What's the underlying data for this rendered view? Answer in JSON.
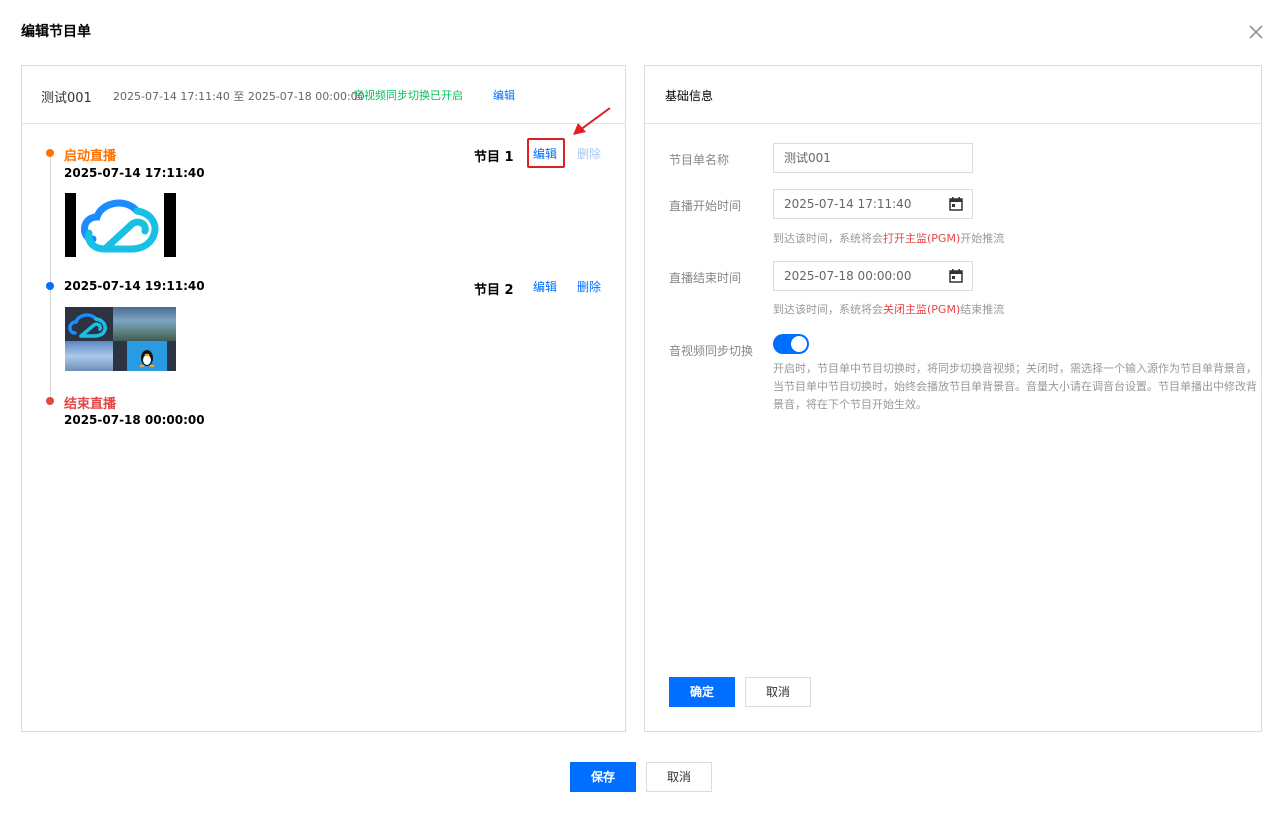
{
  "dialog": {
    "title": "编辑节目单",
    "close_icon": "close-icon"
  },
  "schedule": {
    "name": "测试001",
    "range": "2025-07-14 17:11:40 至 2025-07-18 00:00:00",
    "sync_status": "音视频同步切换已开启",
    "edit_label": "编辑"
  },
  "timeline": {
    "start": {
      "label": "启动直播",
      "time": "2025-07-14 17:11:40"
    },
    "programs": [
      {
        "label": "节目 1",
        "edit": "编辑",
        "delete": "删除",
        "time": ""
      },
      {
        "label": "节目 2",
        "edit": "编辑",
        "delete": "删除",
        "time": "2025-07-14 19:11:40"
      }
    ],
    "end": {
      "label": "结束直播",
      "time": "2025-07-18 00:00:00"
    }
  },
  "info_panel": {
    "title": "基础信息",
    "fields": {
      "name_label": "节目单名称",
      "name_value": "测试001",
      "start_label": "直播开始时间",
      "start_value": "2025-07-14 17:11:40",
      "start_hint_pre": "到达该时间，系统将会",
      "start_hint_em": "打开主监(PGM)",
      "start_hint_post": "开始推流",
      "end_label": "直播结束时间",
      "end_value": "2025-07-18 00:00:00",
      "end_hint_pre": "到达该时间，系统将会",
      "end_hint_em": "关闭主监(PGM)",
      "end_hint_post": "结束推流",
      "sync_label": "音视频同步切换",
      "sync_on": true,
      "sync_desc": "开启时，节目单中节目切换时，将同步切换音视频；关闭时，需选择一个输入源作为节目单背景音，当节目单中节目切换时，始终会播放节目单背景音。音量大小请在调音台设置。节目单播出中修改背景音，将在下个节目开始生效。"
    },
    "confirm": "确定",
    "cancel": "取消"
  },
  "footer": {
    "save": "保存",
    "cancel": "取消"
  },
  "colors": {
    "accent": "#006eff",
    "start": "#ff7200",
    "end": "#e54545",
    "success": "#0abf5b"
  }
}
